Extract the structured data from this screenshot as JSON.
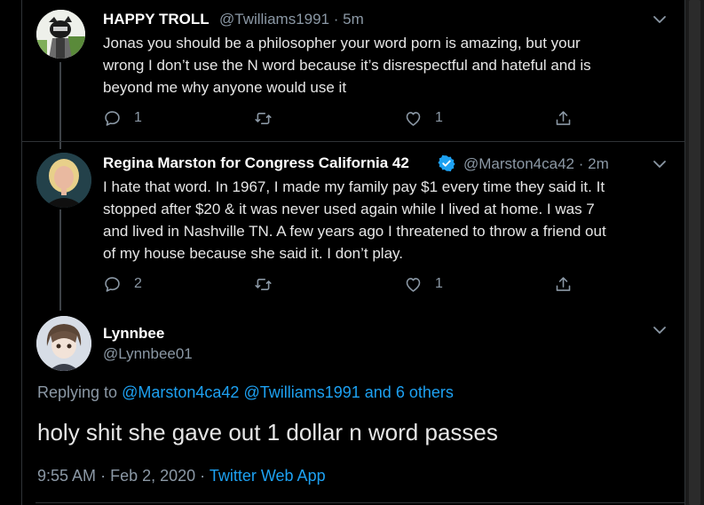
{
  "tweets": [
    {
      "name": "HAPPY TROLL",
      "handle": "@Twilliams1991",
      "time": "5m",
      "text": "Jonas you should be a philosopher your word porn is amazing, but your\nwrong I don’t use the N word because it’s disrespectful and hateful and is\nbeyond me why anyone would use it",
      "replies": "1",
      "retweets": "",
      "likes": "1"
    },
    {
      "name": "Regina Marston for Congress California 42",
      "handle": "@Marston4ca42",
      "time": "2m",
      "verified": true,
      "text": "I hate that word. In 1967, I made my family pay $1 every time they said it. It\nstopped after $20 & it was never used again while I lived at home. I was 7\nand lived in Nashville TN. A few years ago I threatened to throw a friend out\nof my house because she said it. I don’t play.",
      "replies": "2",
      "retweets": "",
      "likes": "1"
    }
  ],
  "focused": {
    "name": "Lynnbee",
    "handle": "@Lynnbee01",
    "replying_prefix": "Replying to",
    "replying_to": [
      "@Marston4ca42",
      "@Twilliams1991"
    ],
    "replying_others": "and 6 others",
    "text": "holy shit she gave out 1 dollar n word passes",
    "time": "9:55 AM",
    "date": "Feb 2, 2020",
    "source": "Twitter Web App"
  },
  "separator": "·",
  "colors": {
    "background": "#000000",
    "accent": "#1da1f2",
    "secondary_text": "#8b98a5",
    "divider": "#2f3336"
  },
  "icons": [
    "reply-icon",
    "retweet-icon",
    "like-icon",
    "share-icon",
    "chevron-down-icon",
    "verified-badge-icon"
  ]
}
